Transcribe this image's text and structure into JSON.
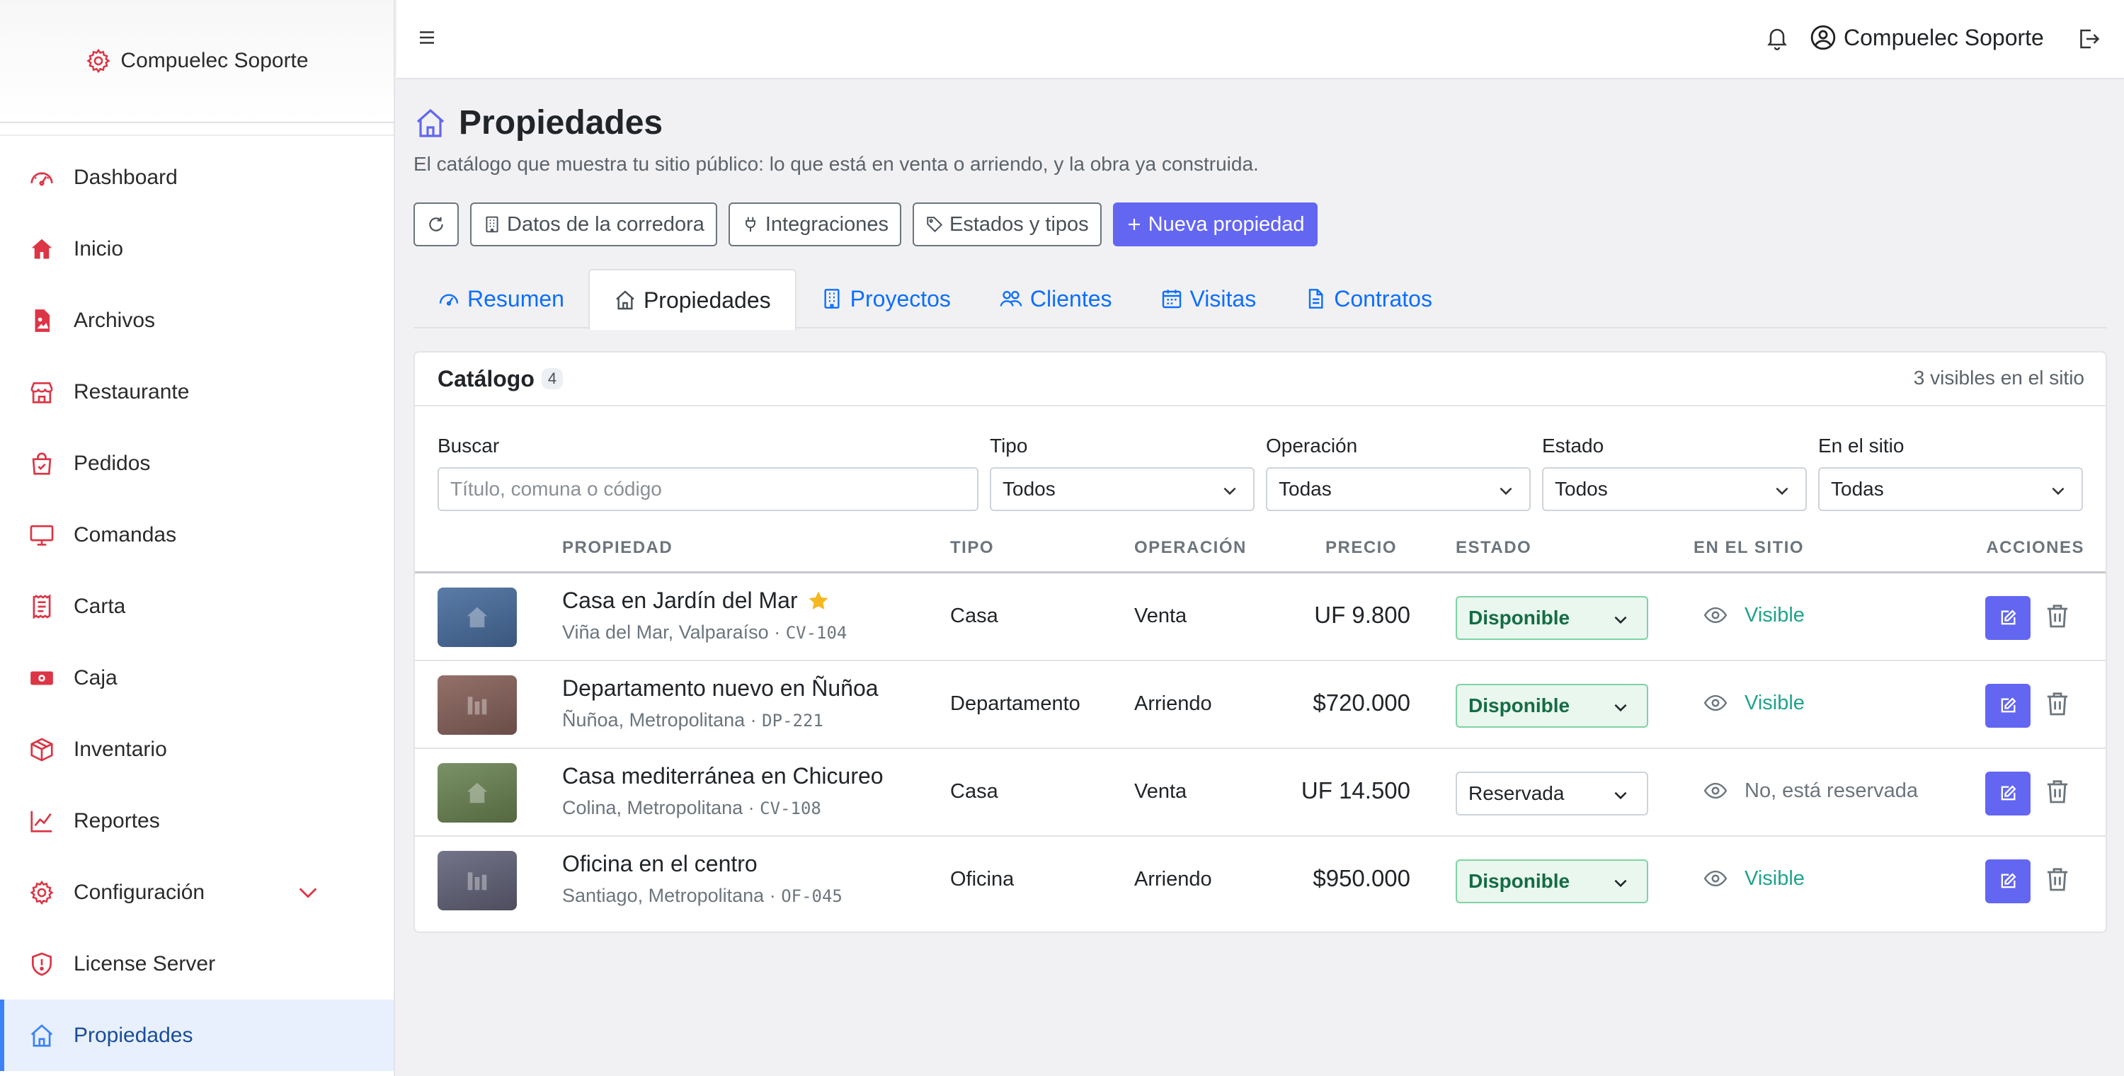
{
  "sidebar": {
    "brand": "Compuelec Soporte",
    "items": [
      {
        "label": "Dashboard",
        "icon": "gauge-icon"
      },
      {
        "label": "Inicio",
        "icon": "home-icon"
      },
      {
        "label": "Archivos",
        "icon": "file-image-icon"
      },
      {
        "label": "Restaurante",
        "icon": "shop-icon"
      },
      {
        "label": "Pedidos",
        "icon": "bag-check-icon"
      },
      {
        "label": "Comandas",
        "icon": "monitor-icon"
      },
      {
        "label": "Carta",
        "icon": "receipt-icon"
      },
      {
        "label": "Caja",
        "icon": "cash-icon"
      },
      {
        "label": "Inventario",
        "icon": "box-icon"
      },
      {
        "label": "Reportes",
        "icon": "graph-icon"
      },
      {
        "label": "Configuración",
        "icon": "gear-icon"
      },
      {
        "label": "License Server",
        "icon": "shield-icon"
      },
      {
        "label": "Propiedades",
        "icon": "house-icon",
        "active": true
      }
    ]
  },
  "topbar": {
    "user_name": "Compuelec Soporte"
  },
  "page": {
    "title": "Propiedades",
    "subtitle": "El catálogo que muestra tu sitio público: lo que está en venta o arriendo, y la obra ya construida."
  },
  "toolbar": {
    "datos": "Datos de la corredora",
    "integraciones": "Integraciones",
    "estados": "Estados y tipos",
    "nueva": "Nueva propiedad"
  },
  "tabs": [
    {
      "label": "Resumen"
    },
    {
      "label": "Propiedades",
      "active": true
    },
    {
      "label": "Proyectos"
    },
    {
      "label": "Clientes"
    },
    {
      "label": "Visitas"
    },
    {
      "label": "Contratos"
    }
  ],
  "catalog": {
    "title": "Catálogo",
    "count": "4",
    "visible_note": "3 visibles en el sitio",
    "filters": {
      "search_label": "Buscar",
      "search_placeholder": "Título, comuna o código",
      "tipo_label": "Tipo",
      "tipo_value": "Todos",
      "operacion_label": "Operación",
      "operacion_value": "Todas",
      "estado_label": "Estado",
      "estado_value": "Todos",
      "sitio_label": "En el sitio",
      "sitio_value": "Todas"
    },
    "columns": {
      "propiedad": "PROPIEDAD",
      "tipo": "TIPO",
      "operacion": "OPERACIÓN",
      "precio": "PRECIO",
      "estado": "ESTADO",
      "sitio": "EN EL SITIO",
      "acciones": "ACCIONES"
    },
    "rows": [
      {
        "title": "Casa en Jardín del Mar",
        "featured": true,
        "location": "Viña del Mar, Valparaíso",
        "code": "CV-104",
        "tipo": "Casa",
        "operacion": "Venta",
        "precio": "UF 9.800",
        "estado": "Disponible",
        "sitio": "Visible",
        "thumb_color": "#4a6a93",
        "thumb_icon": "house-icon"
      },
      {
        "title": "Departamento nuevo en Ñuñoa",
        "featured": false,
        "location": "Ñuñoa, Metropolitana",
        "code": "DP-221",
        "tipo": "Departamento",
        "operacion": "Arriendo",
        "precio": "$720.000",
        "estado": "Disponible",
        "sitio": "Visible",
        "thumb_color": "#7d5e59",
        "thumb_icon": "building-icon"
      },
      {
        "title": "Casa mediterránea en Chicureo",
        "featured": false,
        "location": "Colina, Metropolitana",
        "code": "CV-108",
        "tipo": "Casa",
        "operacion": "Venta",
        "precio": "UF 14.500",
        "estado": "Reservada",
        "sitio": "No, está reservada",
        "thumb_color": "#667a55",
        "thumb_icon": "house-icon"
      },
      {
        "title": "Oficina en el centro",
        "featured": false,
        "location": "Santiago, Metropolitana",
        "code": "OF-045",
        "tipo": "Oficina",
        "operacion": "Arriendo",
        "precio": "$950.000",
        "estado": "Disponible",
        "sitio": "Visible",
        "thumb_color": "#5c5c6e",
        "thumb_icon": "building-icon"
      }
    ]
  },
  "colors": {
    "primary": "#6366f1",
    "sidebar_icon": "#dc3545",
    "link": "#0d6efd",
    "success": "#146c43",
    "visible": "#20a28a"
  }
}
